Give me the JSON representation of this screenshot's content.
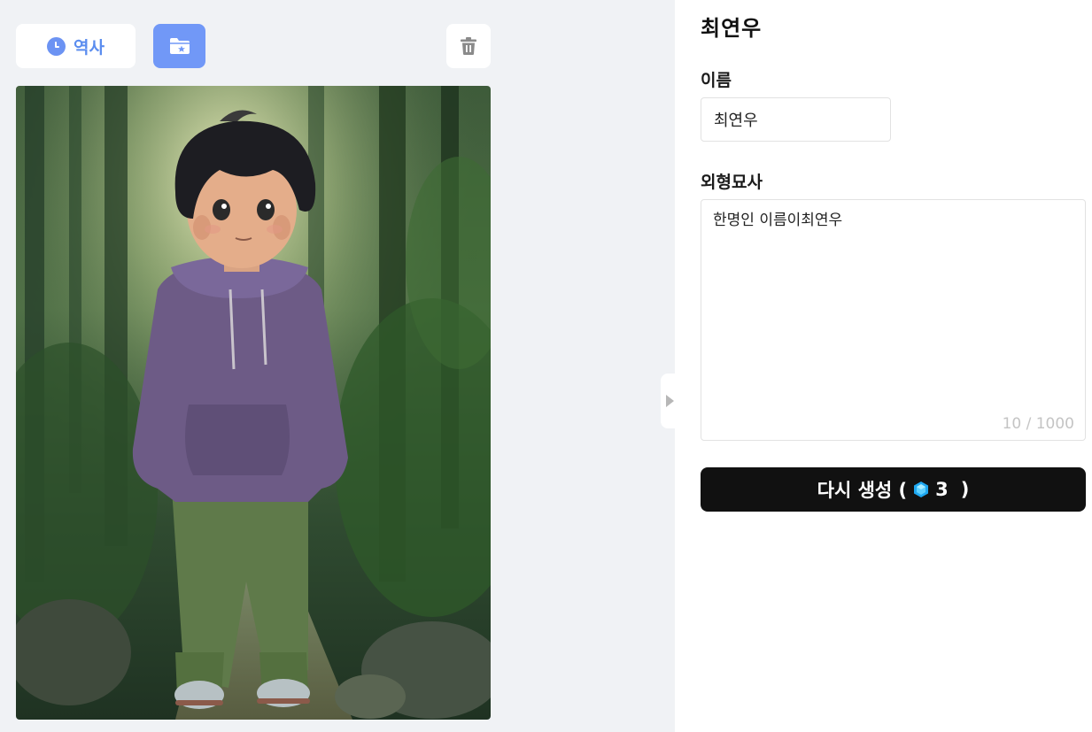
{
  "toolbar": {
    "history_label": "역사",
    "history_icon": "clock-icon",
    "folder_icon": "folder-star-icon",
    "trash_icon": "trash-icon"
  },
  "image": {
    "subject": "character-portrait"
  },
  "character": {
    "title": "최연우",
    "name_label": "이름",
    "name_value": "최연우",
    "description_label": "외형묘사",
    "description_value": "한명인 이름이최연우",
    "char_count": "10 / 1000"
  },
  "regenerate": {
    "label": "다시 생성 (",
    "cost": "3",
    "close": ")",
    "icon": "gem-icon"
  },
  "colors": {
    "accent": "#7198f7",
    "primary_button": "#111111"
  }
}
